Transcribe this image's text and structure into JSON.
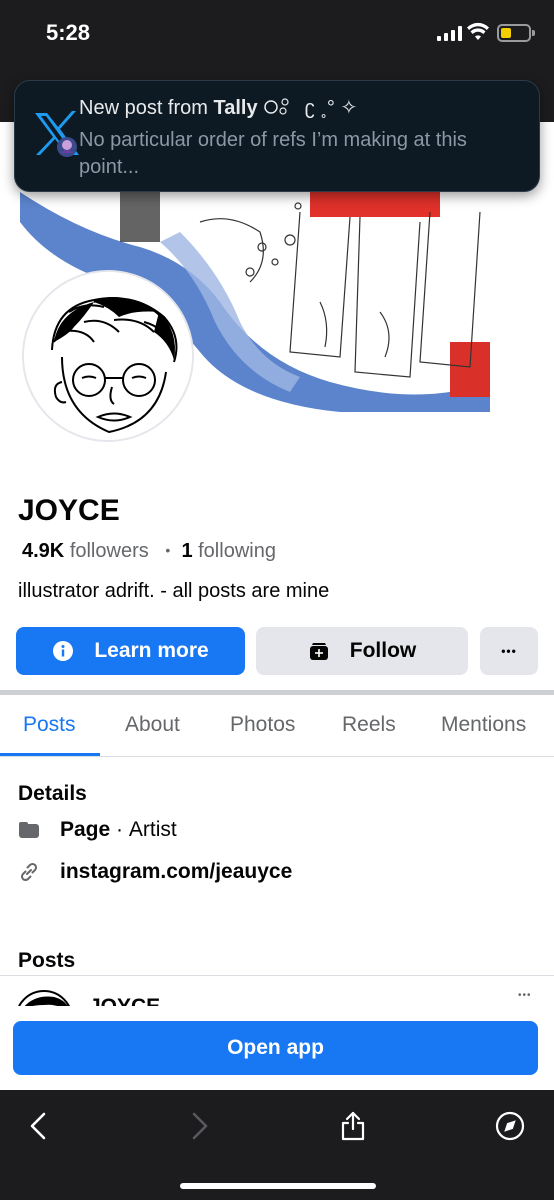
{
  "status_bar": {
    "time": "5:28"
  },
  "notification": {
    "prefix": "New post from ",
    "author": "Tally",
    "decoration": " ʗ ˳° ✧",
    "body": "No particular order of refs I’m making at this point..."
  },
  "profile": {
    "name": "JOYCE",
    "followers_count": "4.9K",
    "followers_label": "followers",
    "separator": "•",
    "following_count": "1",
    "following_label": "following",
    "bio": "illustrator adrift. - all posts are mine"
  },
  "actions": {
    "learn_more": "Learn more",
    "follow": "Follow",
    "more": "•••"
  },
  "tabs": [
    {
      "label": "Posts",
      "active": true
    },
    {
      "label": "About",
      "active": false
    },
    {
      "label": "Photos",
      "active": false
    },
    {
      "label": "Reels",
      "active": false
    },
    {
      "label": "Mentions",
      "active": false
    }
  ],
  "details": {
    "title": "Details",
    "page_label": "Page",
    "page_sep": " · ",
    "page_category": "Artist",
    "link": "instagram.com/jeauyce"
  },
  "posts": {
    "title": "Posts",
    "preview_author": "JOYCE",
    "more": "•••"
  },
  "open_app": "Open app",
  "colors": {
    "brand_blue": "#1877f2",
    "status_bar_bg": "#1c1c1e",
    "notification_bg": "#0d1a24",
    "button_gray": "#e4e6eb",
    "battery_yellow": "#f5d000"
  },
  "icons": [
    "x-app-icon",
    "info-icon",
    "follow-icon",
    "page-icon",
    "link-icon",
    "back-icon",
    "forward-icon",
    "share-icon",
    "compass-icon"
  ]
}
